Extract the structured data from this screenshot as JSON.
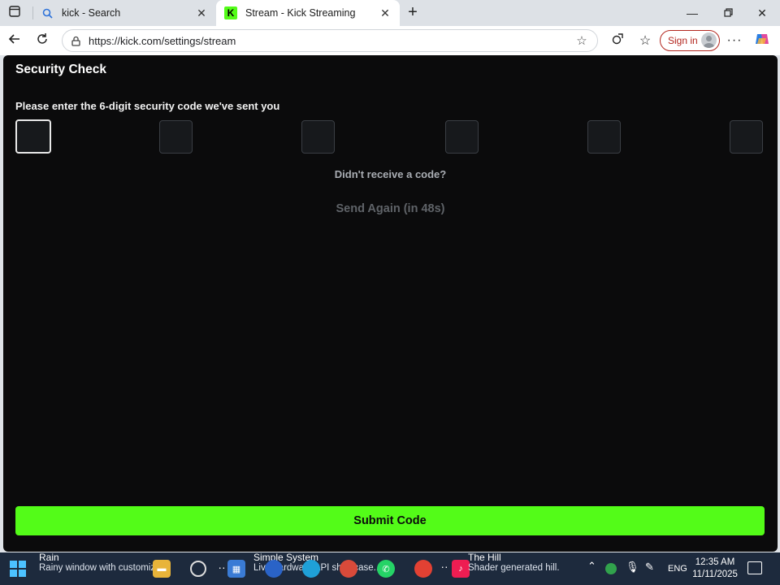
{
  "browser": {
    "tabs": [
      {
        "label": "kick - Search",
        "icon": "search-icon"
      },
      {
        "label": "Stream - Kick Streaming",
        "icon": "kick-logo-icon",
        "active": true
      }
    ],
    "url": "https://kick.com/settings/stream",
    "signin_label": "Sign in"
  },
  "page": {
    "heading": "Security Check",
    "prompt": "Please enter the 6-digit security code we've sent you",
    "code_length": 6,
    "no_code_text": "Didn't receive a code?",
    "send_again_label": "Send Again (in 48s)",
    "submit_label": "Submit Code"
  },
  "colors": {
    "accent": "#53fc18",
    "page_background": "#0b0b0c",
    "signin_border": "#b3261e"
  },
  "taskbar": {
    "widgets": [
      {
        "title": "Rain",
        "subtitle": "Rainy window with customiz..."
      },
      {
        "title": "Simple System",
        "subtitle": "Live hardware API showcase..."
      },
      {
        "title": "The Hill",
        "subtitle": "Shader generated hill."
      }
    ],
    "language": "ENG",
    "time": "12:35 AM",
    "date": "11/11/2025"
  }
}
